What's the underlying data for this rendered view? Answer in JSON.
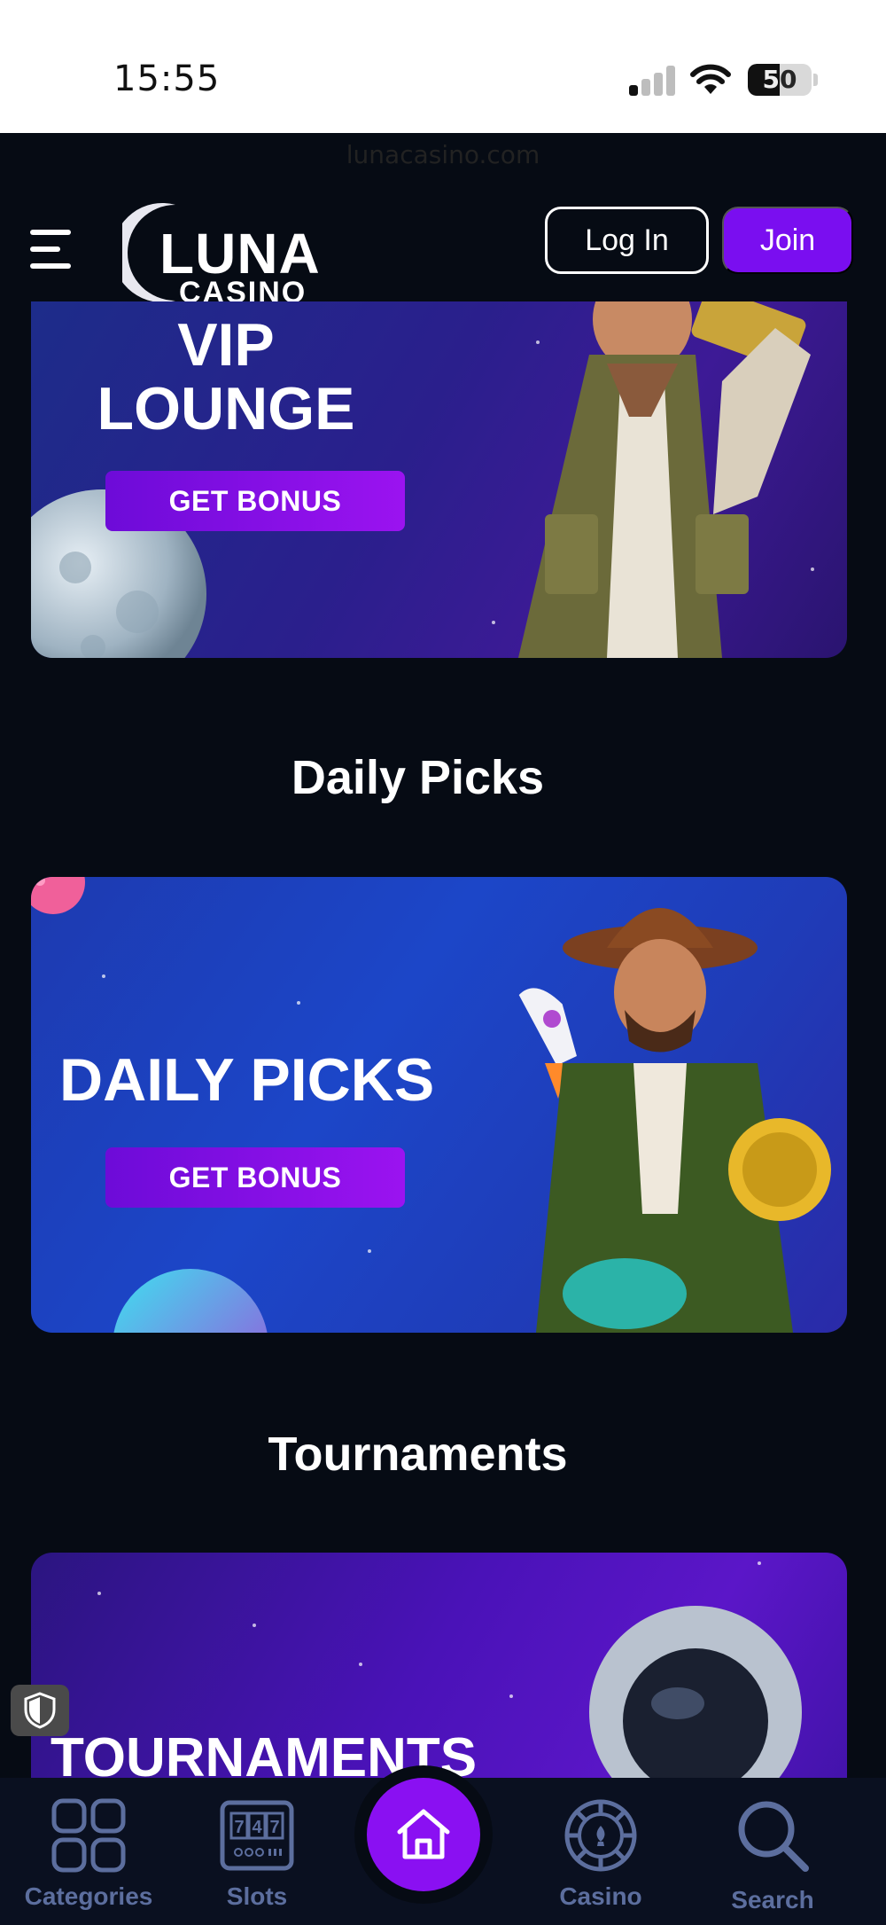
{
  "status_bar": {
    "time": "15:55",
    "battery_level": "50",
    "battery_fraction": 0.5
  },
  "browser": {
    "url": "lunacasino.com"
  },
  "header": {
    "logo_top": "LUNA",
    "logo_bottom": "CASINO",
    "login_label": "Log In",
    "join_label": "Join",
    "accent_color": "#7a0ef0"
  },
  "banners": [
    {
      "title_line1": "VIP",
      "title_line2": "LOUNGE",
      "button_label": "GET BONUS"
    },
    {
      "title": "DAILY PICKS",
      "button_label": "GET BONUS"
    },
    {
      "title": "TOURNAMENTS"
    }
  ],
  "sections": {
    "daily_picks": "Daily Picks",
    "tournaments": "Tournaments"
  },
  "bottom_nav": {
    "items": [
      {
        "label": "Categories",
        "icon": "categories-grid-icon"
      },
      {
        "label": "Slots",
        "icon": "slot-machine-icon",
        "reels": "747"
      },
      {
        "label": "",
        "icon": "home-icon"
      },
      {
        "label": "Casino",
        "icon": "casino-chip-icon"
      },
      {
        "label": "Search",
        "icon": "search-icon"
      }
    ]
  }
}
